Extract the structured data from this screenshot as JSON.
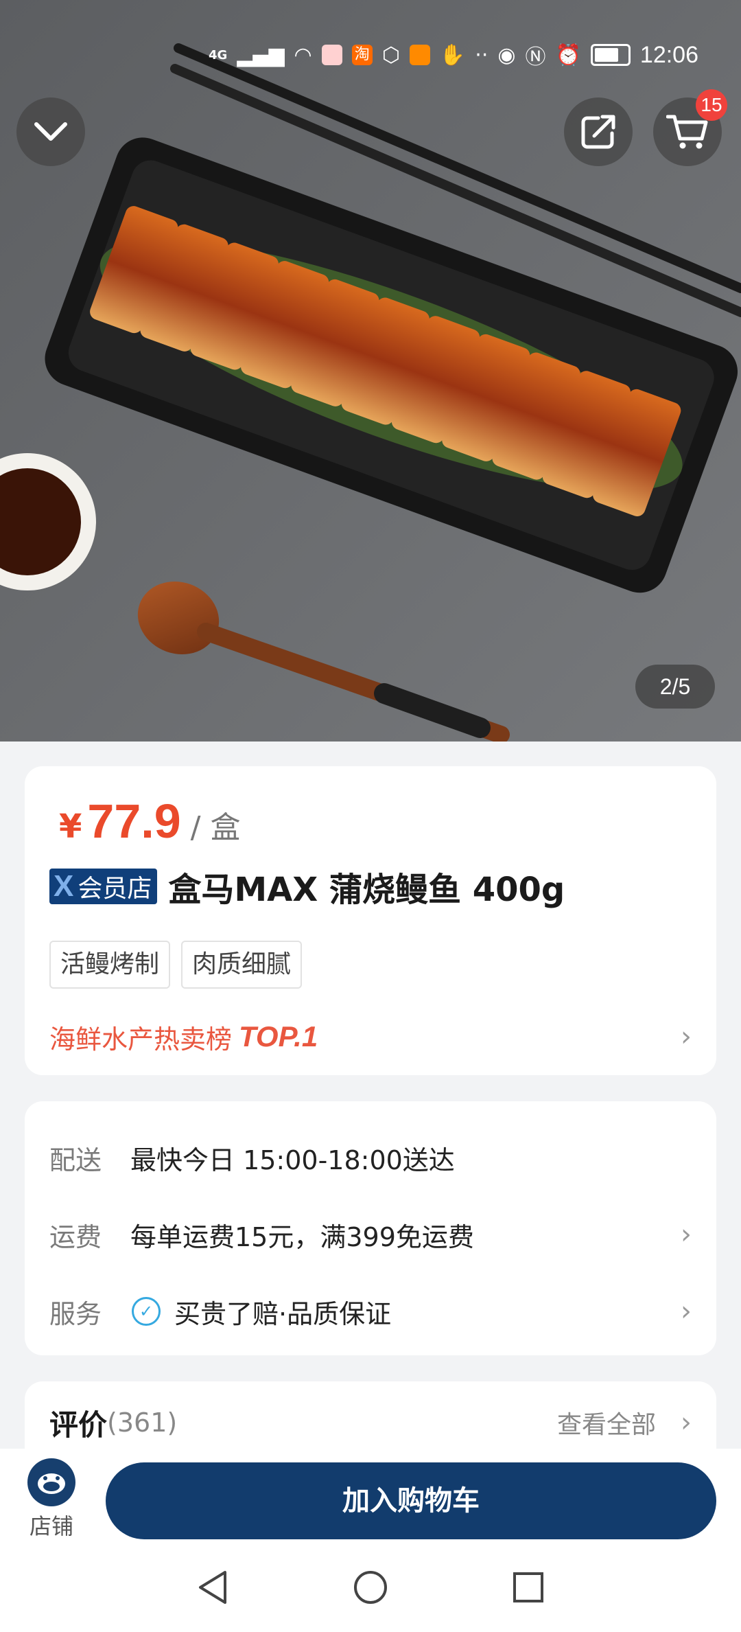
{
  "status_bar": {
    "network": "4G",
    "app_icon_label": "淘",
    "time": "12:06"
  },
  "hero": {
    "cart_badge": "15",
    "pager": "2/5"
  },
  "product": {
    "currency": "¥",
    "price": "77.9",
    "unit": "/ 盒",
    "member_tag": "会员店",
    "title": "盒马MAX 蒲烧鳗鱼 400g",
    "tags": [
      "活鳗烤制",
      "肉质细腻"
    ],
    "rank_text": "海鲜水产热卖榜",
    "rank_top": "TOP.1"
  },
  "delivery": {
    "rows": [
      {
        "label": "配送",
        "value": "最快今日 15:00-18:00送达"
      },
      {
        "label": "运费",
        "value": "每单运费15元，满399免运费"
      },
      {
        "label": "服务",
        "value": "买贵了赔·品质保证"
      }
    ]
  },
  "reviews": {
    "title": "评价",
    "count": "(361)",
    "see_all": "查看全部"
  },
  "bottom_bar": {
    "store_label": "店铺",
    "add_to_cart": "加入购物车"
  },
  "colors": {
    "price_red": "#ea4a2b",
    "brand_navy": "#123c6d",
    "badge_red": "#f0423c"
  }
}
